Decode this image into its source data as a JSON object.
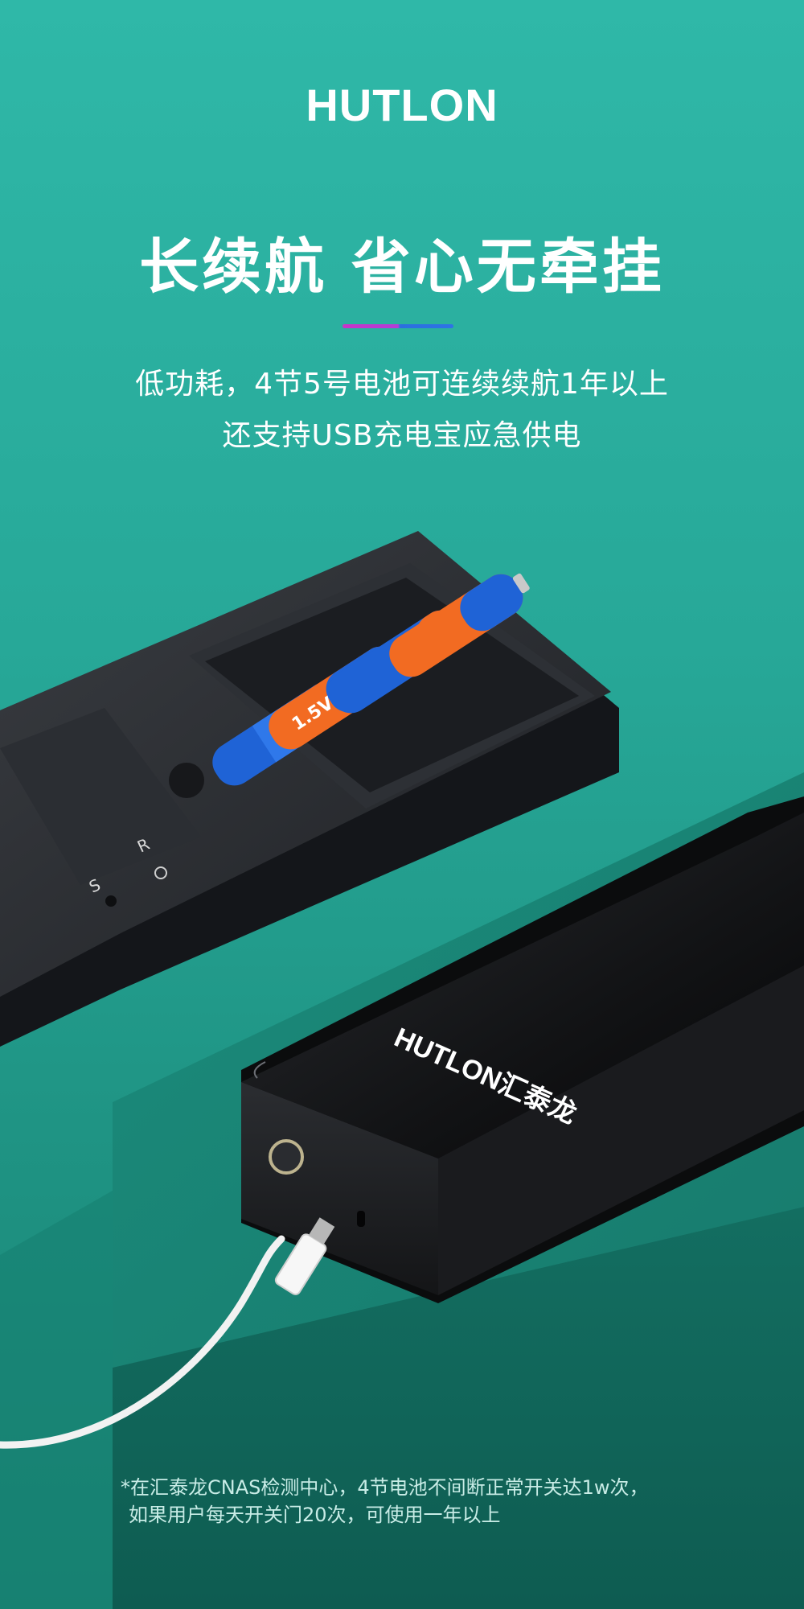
{
  "brand": {
    "name": "HUTLON"
  },
  "hero": {
    "headline": "长续航  省心无牵挂",
    "subline1": "低功耗，4节5号电池可连续续航1年以上",
    "subline2": "还支持USB充电宝应急供电"
  },
  "product": {
    "device_logo": "HUTLON汇泰龙",
    "battery_label": "1.5V",
    "button_labels": [
      "R",
      "S"
    ]
  },
  "footnote": {
    "line1": "*在汇泰龙CNAS检测中心，4节电池不间断正常开关达1w次，",
    "line2": "如果用户每天开关门20次，可使用一年以上"
  },
  "colors": {
    "background": "#27a898",
    "accent_magenta": "#c833c8",
    "accent_blue": "#2e73e6",
    "battery_blue": "#1f63d6",
    "battery_orange": "#f26b22"
  }
}
